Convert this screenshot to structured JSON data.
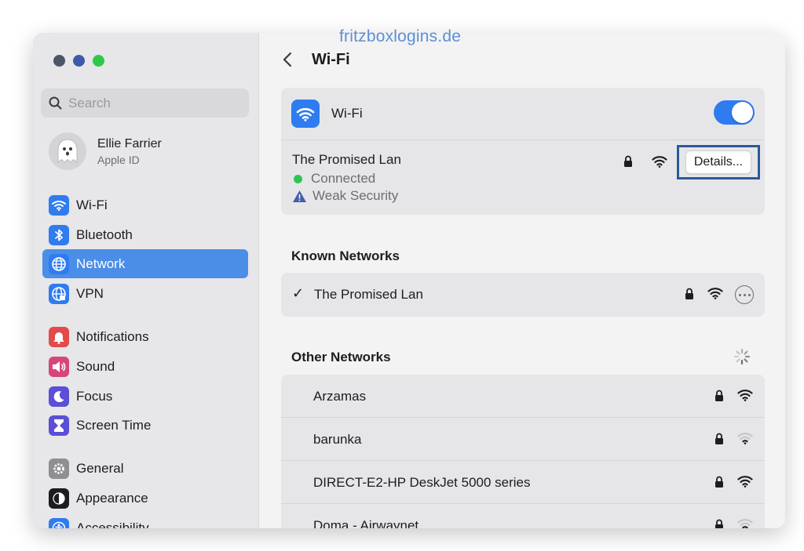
{
  "watermark": "fritzboxlogins.de",
  "sidebar": {
    "search": {
      "placeholder": "Search",
      "value": ""
    },
    "account": {
      "name": "Ellie Farrier",
      "subtitle": "Apple ID"
    },
    "items": [
      {
        "label": "Wi-Fi",
        "icon": "wifi-icon",
        "color": "#2f7bf0"
      },
      {
        "label": "Bluetooth",
        "icon": "bluetooth-icon",
        "color": "#2f7bf0"
      },
      {
        "label": "Network",
        "icon": "globe-icon",
        "color": "#2f7bf0",
        "active": true
      },
      {
        "label": "VPN",
        "icon": "globe-vpn-icon",
        "color": "#2f7bf0"
      },
      {
        "label": "Notifications",
        "icon": "bell-icon",
        "color": "#e34b4b"
      },
      {
        "label": "Sound",
        "icon": "speaker-icon",
        "color": "#d7467a"
      },
      {
        "label": "Focus",
        "icon": "moon-icon",
        "color": "#5a4fd6"
      },
      {
        "label": "Screen Time",
        "icon": "hourglass-icon",
        "color": "#5a4fd6"
      },
      {
        "label": "General",
        "icon": "gear-icon",
        "color": "#8e8e93"
      },
      {
        "label": "Appearance",
        "icon": "appearance-icon",
        "color": "#1d1d1f"
      },
      {
        "label": "Accessibility",
        "icon": "accessibility-icon",
        "color": "#2f7bf0"
      }
    ]
  },
  "main": {
    "title": "Wi-Fi",
    "wifi_label": "Wi-Fi",
    "wifi_enabled": true,
    "current": {
      "name": "The Promised Lan",
      "status": "Connected",
      "warning": "Weak Security",
      "details_label": "Details..."
    },
    "known_title": "Known Networks",
    "known": [
      {
        "name": "The Promised Lan",
        "check": "✓"
      }
    ],
    "other_title": "Other Networks",
    "other": [
      {
        "name": "Arzamas",
        "signal": "strong"
      },
      {
        "name": "barunka",
        "signal": "weak"
      },
      {
        "name": "DIRECT-E2-HP DeskJet 5000 series",
        "signal": "strong"
      },
      {
        "name": "Doma - Airwaynet",
        "signal": "weak"
      }
    ]
  }
}
